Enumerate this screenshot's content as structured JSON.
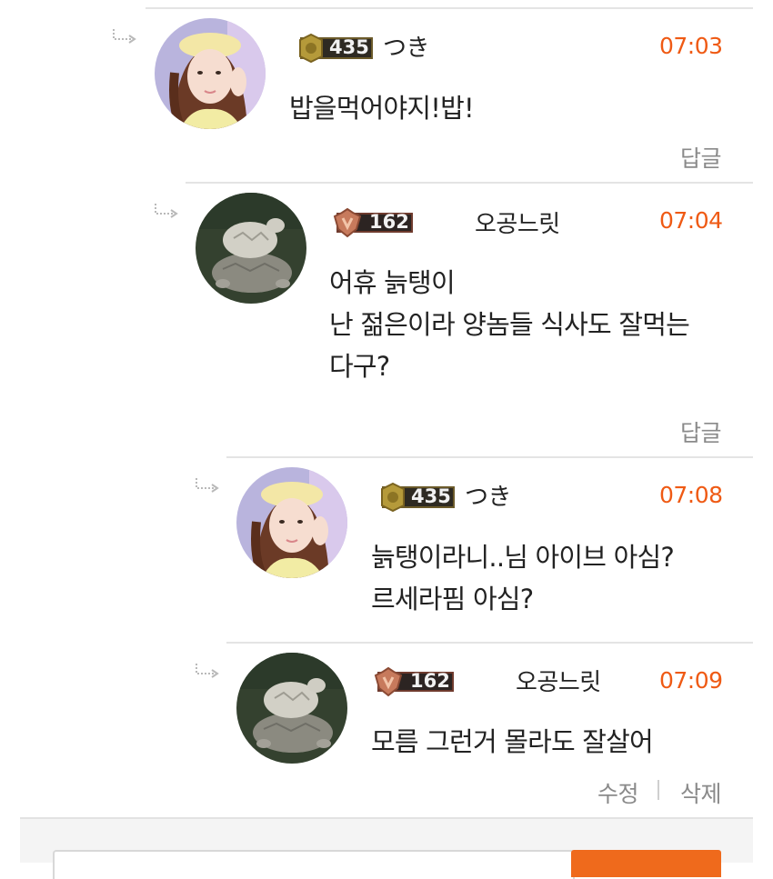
{
  "comments": [
    {
      "nickname": "つき",
      "level": "435",
      "time": "07:03",
      "avatar": "girl-avatar",
      "lines": [
        "밥을먹어야지!밥!"
      ],
      "action": "답글"
    },
    {
      "nickname": "오공느릿",
      "level": "162",
      "time": "07:04",
      "avatar": "turtle-avatar",
      "lines": [
        "어휴 늙탱이",
        "난 젊은이라 양놈들 식사도 잘먹는",
        "다구?"
      ],
      "action": "답글"
    },
    {
      "nickname": "つき",
      "level": "435",
      "time": "07:08",
      "avatar": "girl-avatar",
      "lines": [
        "늙탱이라니..님 아이브 아심?",
        "르세라핌 아심?"
      ]
    },
    {
      "nickname": "오공느릿",
      "level": "162",
      "time": "07:09",
      "avatar": "turtle-avatar",
      "lines": [
        "모름 그런거 몰라도 잘살어"
      ],
      "edit": "수정",
      "delete": "삭제"
    }
  ],
  "colors": {
    "time": "#ef5a14",
    "submit": "#ef6a1c",
    "divider": "#e4e4e4"
  }
}
